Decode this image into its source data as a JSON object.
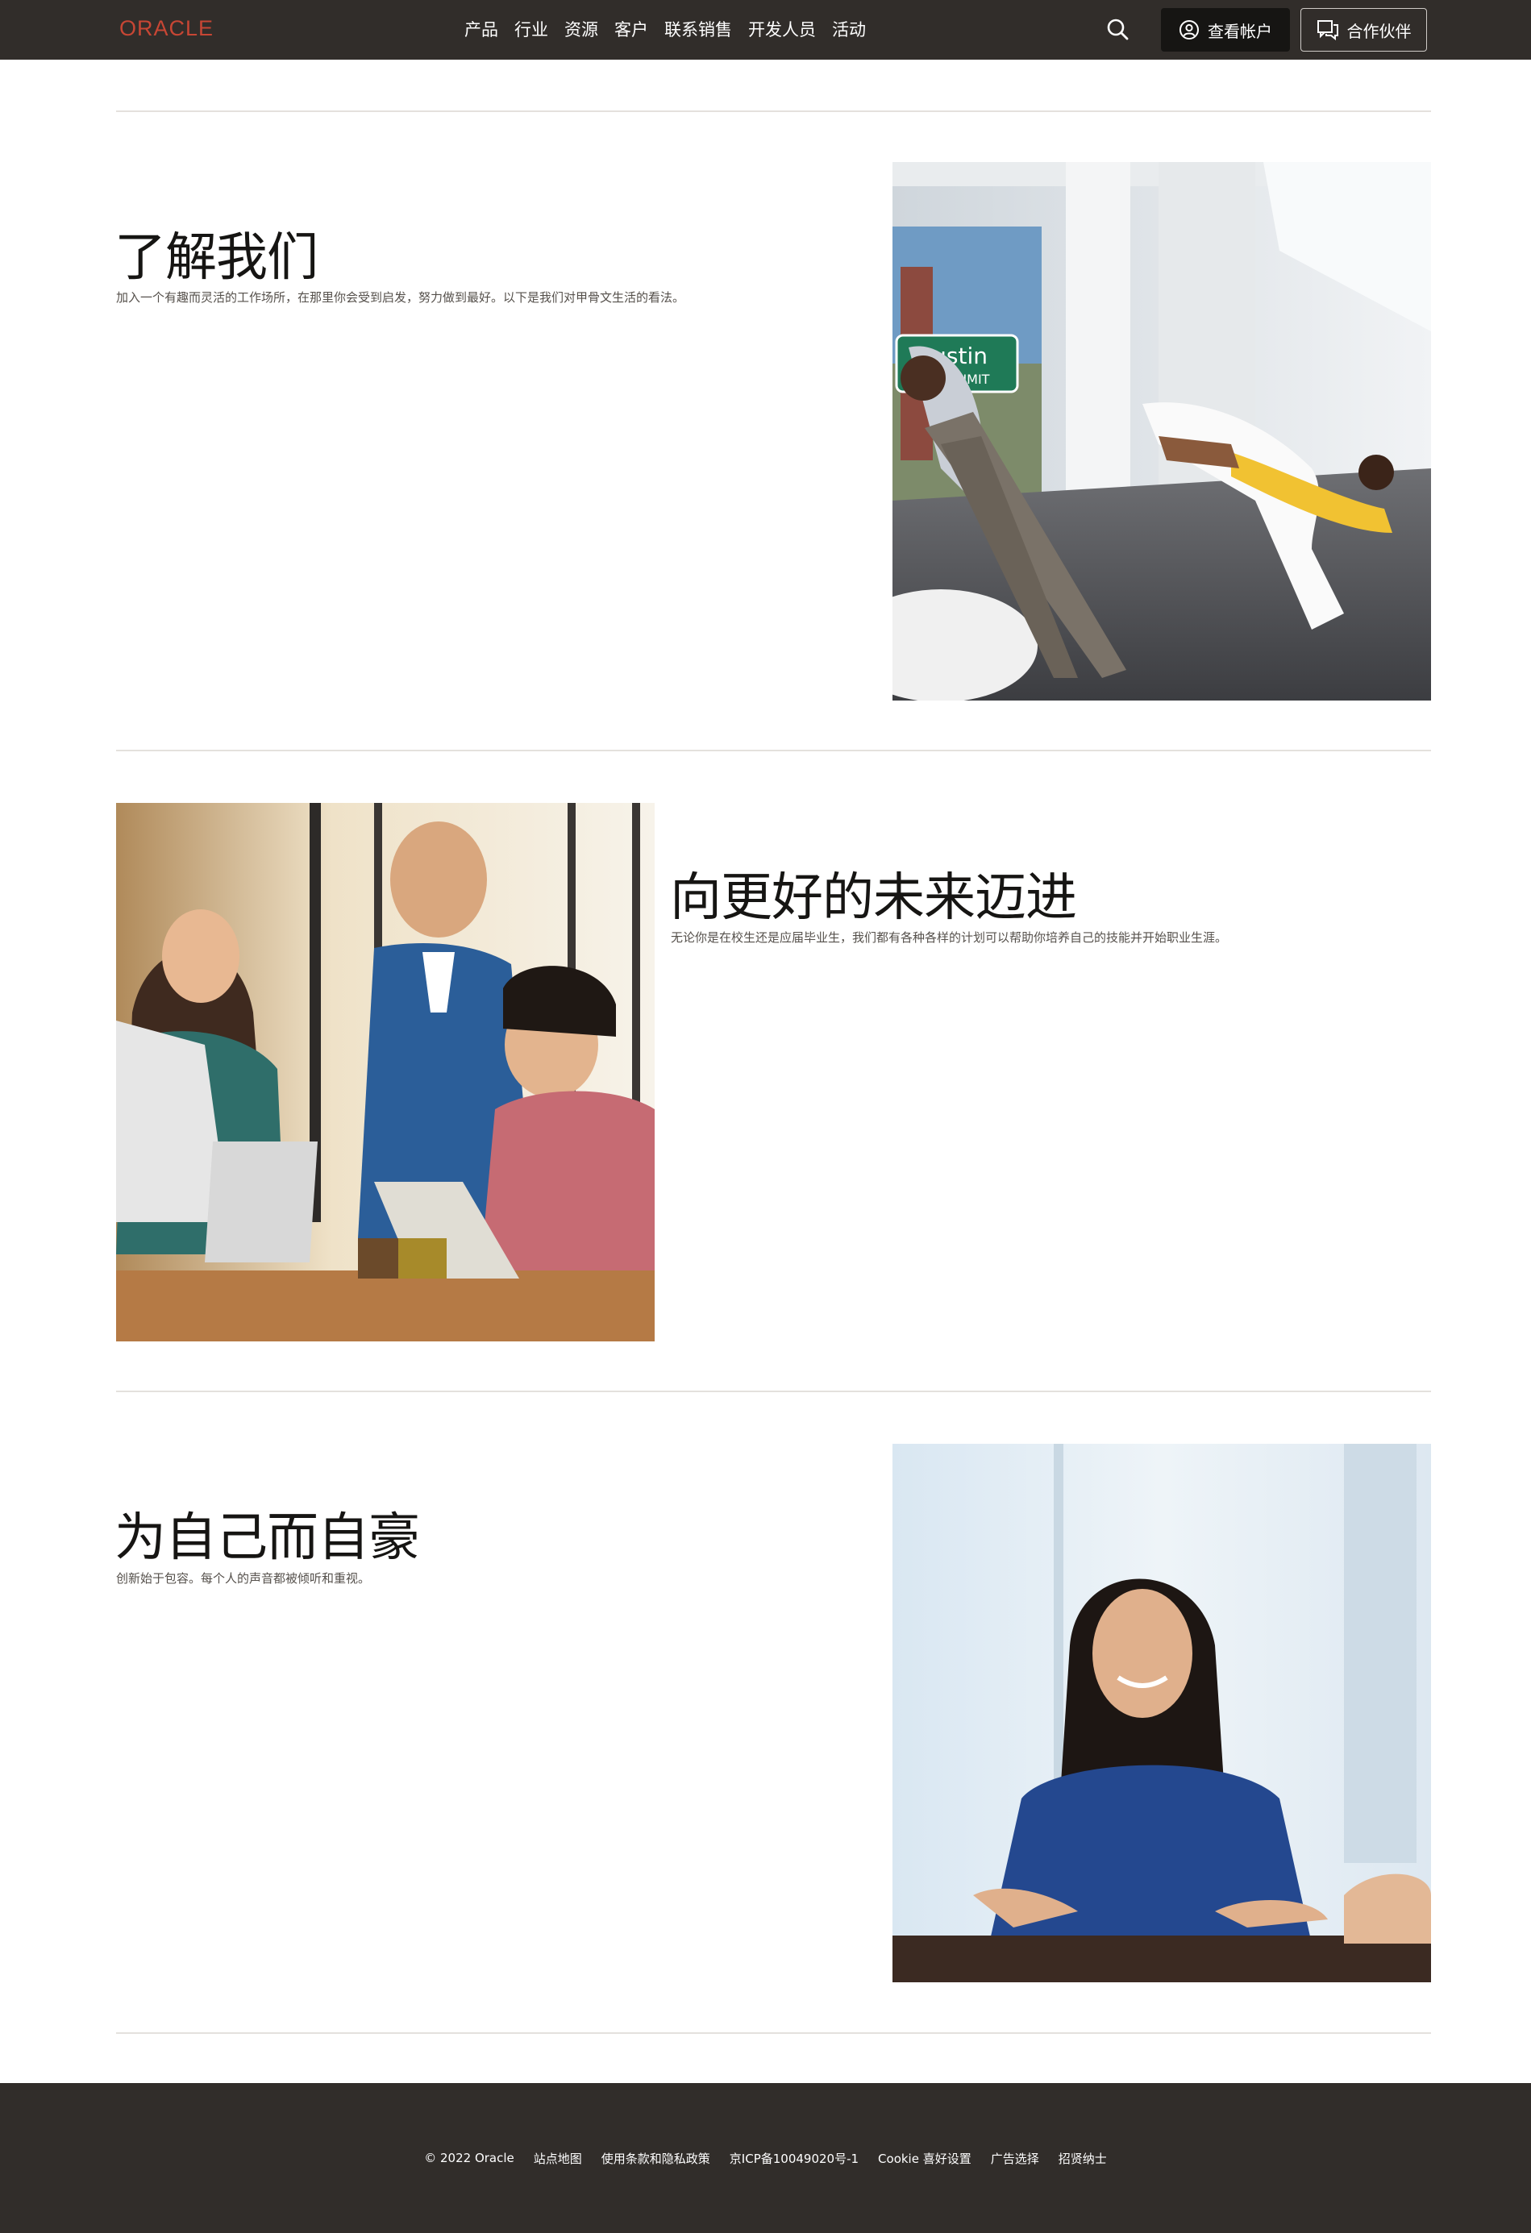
{
  "header": {
    "logo_text": "ORACLE",
    "nav": [
      "产品",
      "行业",
      "资源",
      "客户",
      "联系销售",
      "开发人员",
      "活动"
    ],
    "account_label": "查看帐户",
    "partner_label": "合作伙伴",
    "colors": {
      "bar": "#312d2a",
      "logo": "#c74634",
      "account_bg": "#161513"
    }
  },
  "sections": [
    {
      "title": "了解我们",
      "description": "加入一个有趣而灵活的工作场所，在那里你会受到启发，努力做到最好。以下是我们对甲骨文生活的看法。",
      "image": "office-lounge-photo",
      "sign_text": [
        "Austin",
        "CITY LIMIT"
      ]
    },
    {
      "title": "向更好的未来迈进",
      "description": "无论你是在校生还是应届毕业生，我们都有各种各样的计划可以帮助你培养自己的技能并开始职业生涯。",
      "image": "team-meeting-photo"
    },
    {
      "title": "为自己而自豪",
      "description": "创新始于包容。每个人的声音都被倾听和重视。",
      "image": "smiling-woman-photo"
    }
  ],
  "footer": {
    "copyright": "© 2022 Oracle",
    "links": [
      "站点地图",
      "使用条款和隐私政策",
      "京ICP备10049020号-1",
      "Cookie 喜好设置",
      "广告选择",
      "招贤纳士"
    ]
  }
}
